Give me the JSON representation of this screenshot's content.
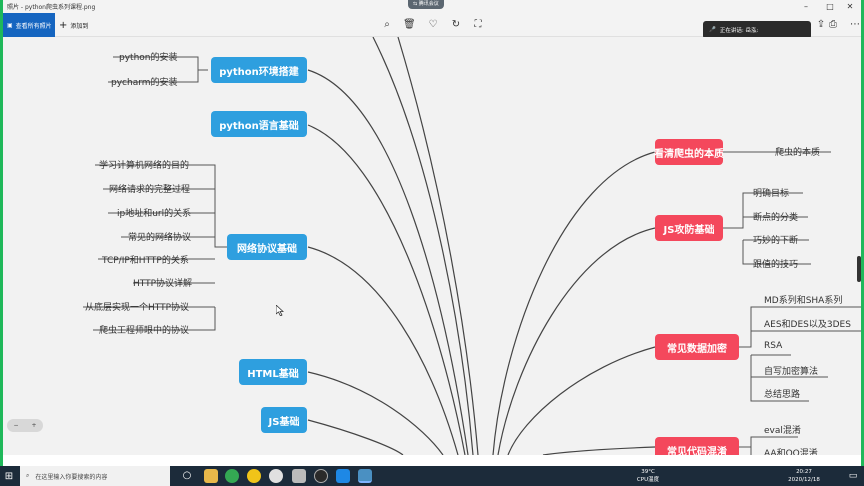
{
  "window": {
    "title": "照片 - python爬虫系列课程.png",
    "minimize": "–",
    "maximize": "□",
    "close": "✕"
  },
  "toolbar": {
    "view_all": "查看所有照片",
    "add": "添加到",
    "meeting": "腾讯会议"
  },
  "speaking": {
    "label": "正在讲话: 岳泓:"
  },
  "mindmap": {
    "left_nodes": [
      {
        "label": "python环境搭建",
        "children": [
          "python的安装",
          "pycharm的安装"
        ]
      },
      {
        "label": "python语言基础",
        "children": []
      },
      {
        "label": "网络协议基础",
        "children": [
          "学习计算机网络的目的",
          "网络请求的完整过程",
          "ip地址和url的关系",
          "常见的网络协议",
          "TCP/IP和HTTP的关系",
          "HTTP协议详解",
          "从底层实现一个HTTP协议",
          "爬虫工程师眼中的协议"
        ]
      },
      {
        "label": "HTML基础",
        "children": []
      },
      {
        "label": "JS基础",
        "children": []
      }
    ],
    "right_nodes": [
      {
        "label": "看清爬虫的本质",
        "children": [
          "爬虫的本质"
        ]
      },
      {
        "label": "JS攻防基础",
        "children": [
          "明确目标",
          "断点的分类",
          "巧妙的下断",
          "跟值的技巧"
        ]
      },
      {
        "label": "常见数据加密",
        "children": [
          "MD系列和SHA系列",
          "AES和DES以及3DES",
          "RSA",
          "自写加密算法",
          "总结思路"
        ]
      },
      {
        "label": "常见代码混淆",
        "children": [
          "eval混淆",
          "AA和OO混淆"
        ]
      }
    ]
  },
  "zoom": {
    "minus": "−",
    "plus": "+"
  },
  "taskbar": {
    "search_placeholder": "在这里输入你要搜索的内容",
    "temperature": "39°C",
    "cpu_label": "CPU温度",
    "time": "20:27",
    "date": "2020/12/18"
  },
  "colors": {
    "blue_node": "#2e9fdf",
    "red_node": "#f4485c",
    "accent": "#1565c0",
    "frame": "#1fb85a"
  }
}
